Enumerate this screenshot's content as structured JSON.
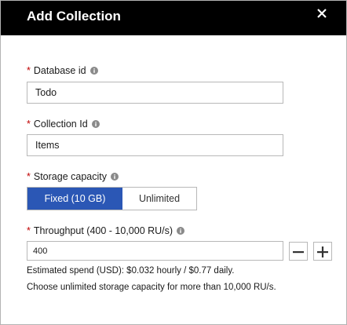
{
  "header": {
    "title": "Add Collection",
    "close_icon": "close-icon"
  },
  "form": {
    "database": {
      "required_mark": "*",
      "label": "Database id",
      "value": "Todo"
    },
    "collection": {
      "required_mark": "*",
      "label": "Collection Id",
      "value": "Items"
    },
    "storage": {
      "required_mark": "*",
      "label": "Storage capacity",
      "options": [
        "Fixed (10 GB)",
        "Unlimited"
      ],
      "selected": "Fixed (10 GB)"
    },
    "throughput": {
      "required_mark": "*",
      "label": "Throughput (400 - 10,000 RU/s)",
      "value": "400",
      "decrement_icon": "minus-icon",
      "increment_icon": "plus-icon"
    },
    "notes": {
      "spend": "Estimated spend (USD): $0.032 hourly / $0.77 daily.",
      "hint": "Choose unlimited storage capacity for more than 10,000 RU/s."
    }
  },
  "colors": {
    "header_bg": "#000000",
    "accent": "#2b57b5",
    "required": "#c00000"
  }
}
